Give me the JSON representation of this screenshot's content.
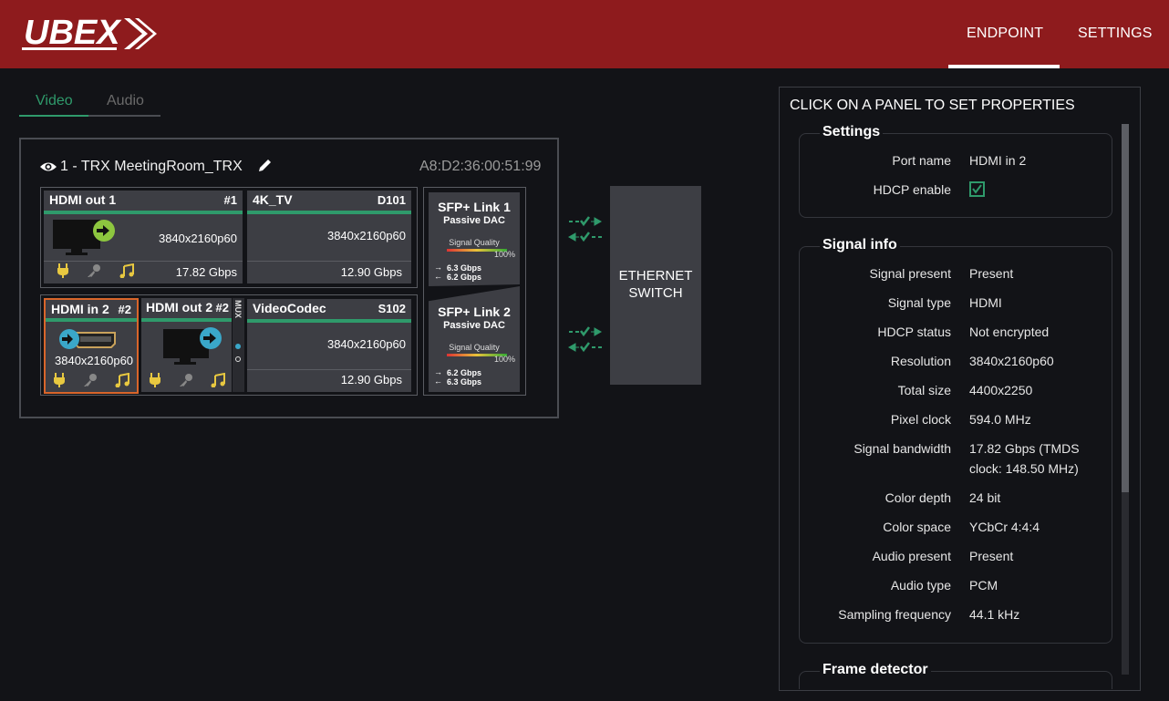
{
  "brand": {
    "logo_text": "UBEX",
    "accent": "#2f9a6b",
    "header_bg": "#8e1b1d"
  },
  "nav": {
    "endpoint": "ENDPOINT",
    "settings": "SETTINGS"
  },
  "tabs": {
    "video": "Video",
    "audio": "Audio"
  },
  "endpoint": {
    "title": "1 - TRX  MeetingRoom_TRX",
    "mac": "A8:D2:36:00:51:99",
    "row1": {
      "port": {
        "name": "HDMI out 1",
        "num": "#1",
        "resolution": "3840x2160p60",
        "bandwidth": "17.82 Gbps"
      },
      "device": {
        "name": "4K_TV",
        "id": "D101",
        "resolution": "3840x2160p60",
        "bandwidth": "12.90 Gbps"
      }
    },
    "row2": {
      "port_in": {
        "name": "HDMI in 2",
        "num": "#2",
        "resolution": "3840x2160p60"
      },
      "port_out": {
        "name": "HDMI out 2",
        "num": "#2",
        "mux": "MUX"
      },
      "device": {
        "name": "VideoCodec",
        "id": "S102",
        "resolution": "3840x2160p60",
        "bandwidth": "12.90 Gbps"
      }
    },
    "sfp": [
      {
        "title": "SFP+ Link 1",
        "sub": "Passive DAC",
        "quality_label": "Signal Quality",
        "quality": "100%",
        "tx": "6.3 Gbps",
        "rx": "6.2 Gbps"
      },
      {
        "title": "SFP+ Link 2",
        "sub": "Passive DAC",
        "quality_label": "Signal Quality",
        "quality": "100%",
        "tx": "6.2 Gbps",
        "rx": "6.3 Gbps"
      }
    ],
    "switch_label_1": "ETHERNET",
    "switch_label_2": "SWITCH"
  },
  "properties": {
    "header": "CLICK ON A PANEL TO SET PROPERTIES",
    "settings": {
      "legend": "Settings",
      "port_name_label": "Port name",
      "port_name": "HDMI in 2",
      "hdcp_enable_label": "HDCP enable",
      "hdcp_enable": true
    },
    "signal_info": {
      "legend": "Signal info",
      "rows": [
        {
          "label": "Signal present",
          "value": "Present"
        },
        {
          "label": "Signal type",
          "value": "HDMI"
        },
        {
          "label": "HDCP status",
          "value": "Not encrypted"
        },
        {
          "label": "Resolution",
          "value": "3840x2160p60"
        },
        {
          "label": "Total size",
          "value": "4400x2250"
        },
        {
          "label": "Pixel clock",
          "value": "594.0 MHz"
        },
        {
          "label": "Signal bandwidth",
          "value": "17.82 Gbps (TMDS clock: 148.50 MHz)"
        },
        {
          "label": "Color depth",
          "value": "24 bit"
        },
        {
          "label": "Color space",
          "value": "YCbCr 4:4:4"
        },
        {
          "label": "Audio present",
          "value": "Present"
        },
        {
          "label": "Audio type",
          "value": "PCM"
        },
        {
          "label": "Sampling frequency",
          "value": "44.1 kHz"
        }
      ]
    },
    "frame_detector": {
      "legend": "Frame detector"
    }
  }
}
